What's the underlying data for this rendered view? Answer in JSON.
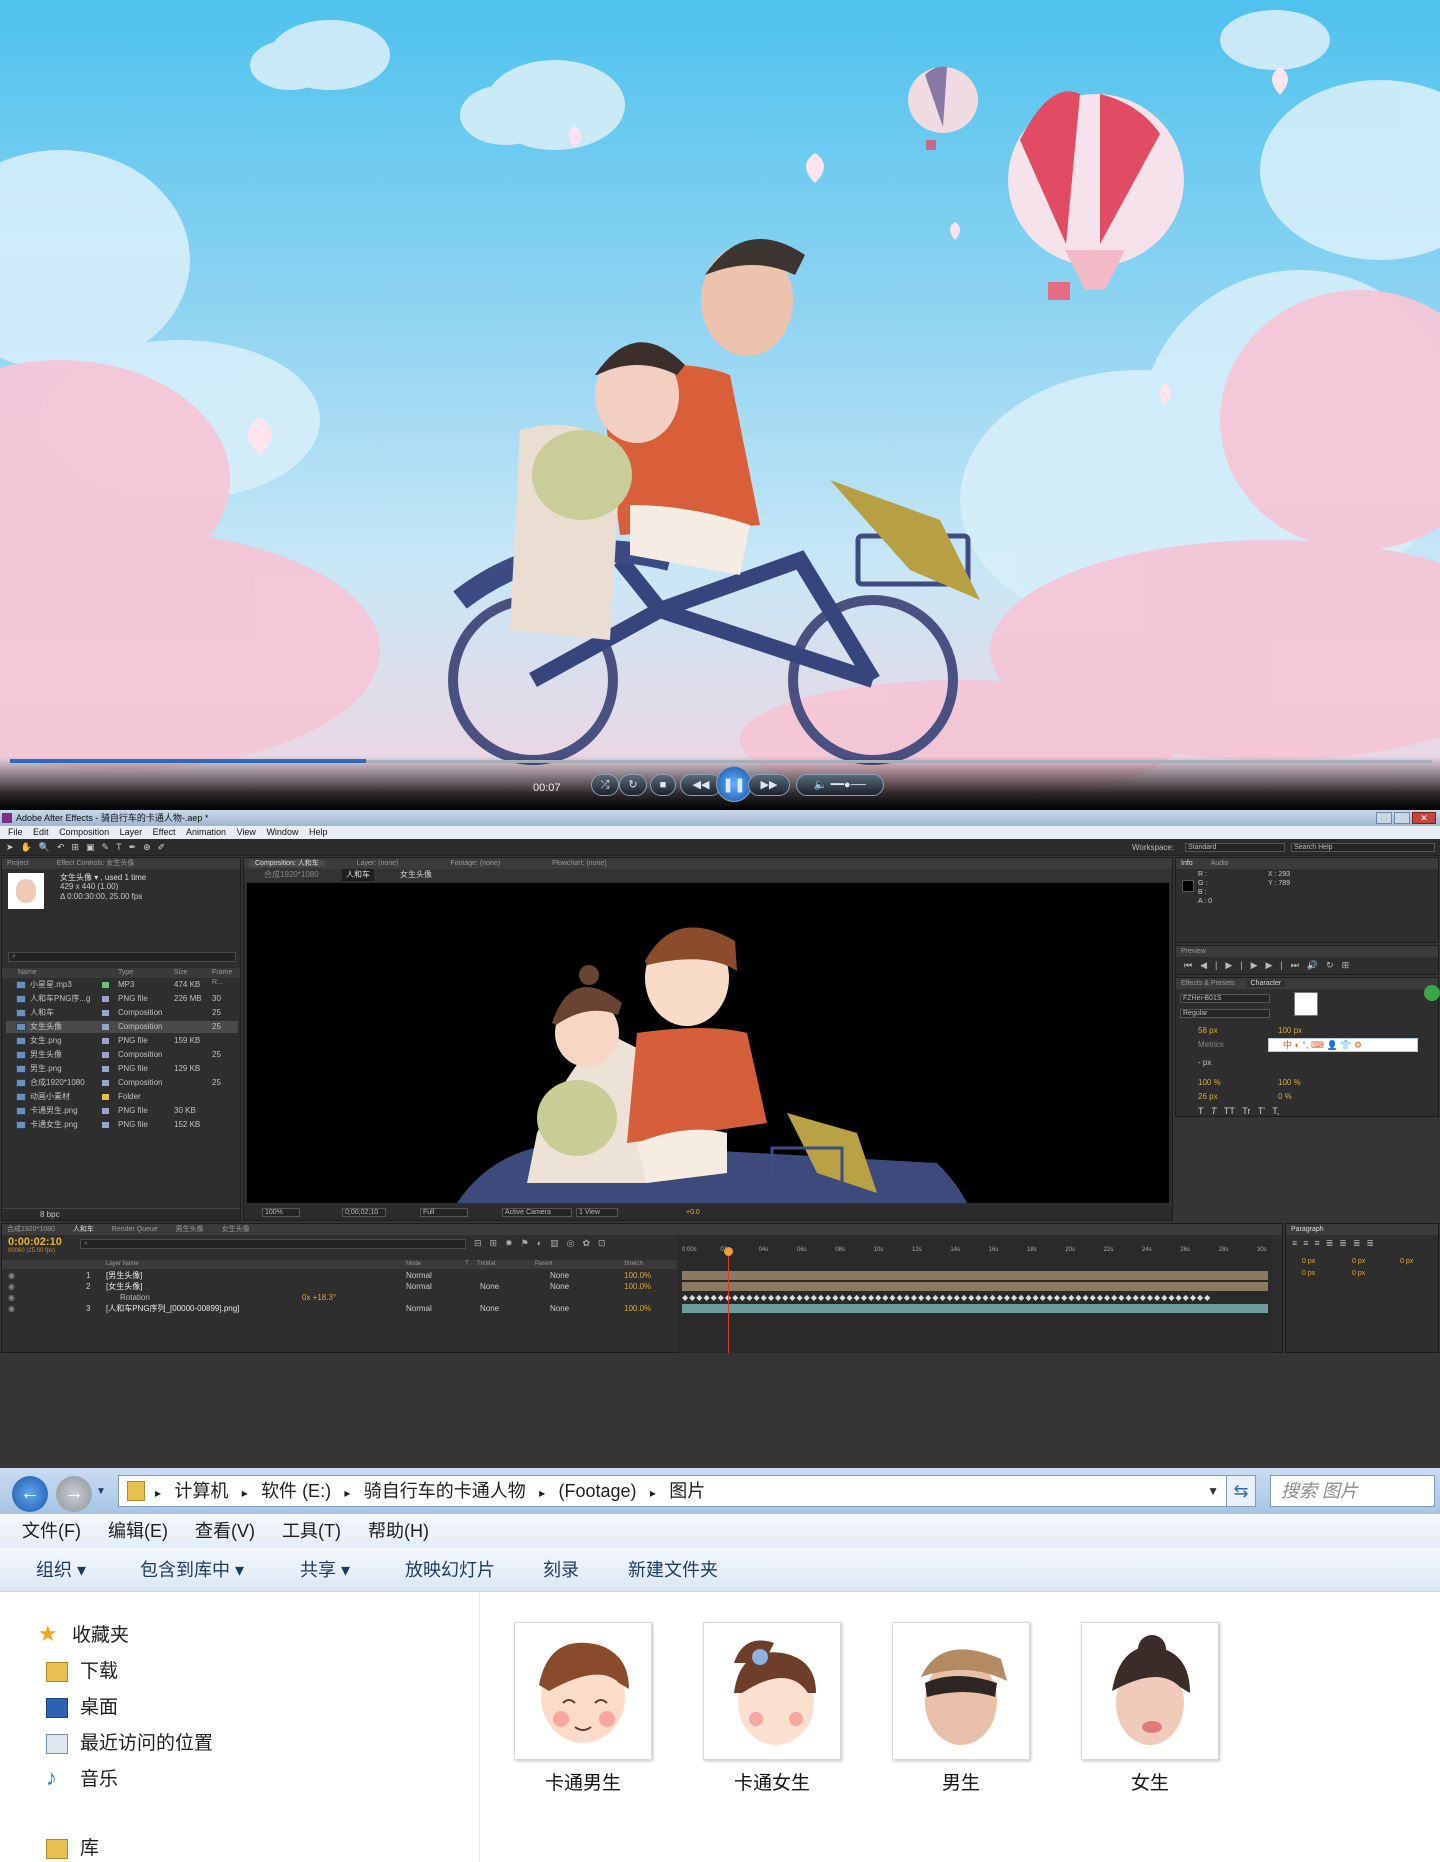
{
  "player": {
    "time": "00:07",
    "progress_fraction": 0.25
  },
  "ae": {
    "title": "Adobe After Effects - 骑自行车的卡通人物-.aep *",
    "menu": [
      "File",
      "Edit",
      "Composition",
      "Layer",
      "Effect",
      "Animation",
      "View",
      "Window",
      "Help"
    ],
    "workspace_label": "Workspace:",
    "workspace_value": "Standard",
    "search_help": "Search Help",
    "project": {
      "tab": "Project",
      "effect_controls_tab": "Effect Controls: 女生头像",
      "selected_name": "女生头像 ▾ , used 1 time",
      "selected_dims": "429 x 440 (1.00)",
      "selected_duration": "Δ 0:00:30:00, 25.00 fps",
      "columns": [
        "Name",
        "Type",
        "Size",
        "Frame R..."
      ],
      "items": [
        {
          "name": "小星星.mp3",
          "type": "MP3",
          "size": "474 KB",
          "fr": "",
          "swatch": "#6dbf7a"
        },
        {
          "name": "人和车PNG序...g",
          "type": "PNG file",
          "size": "226 MB",
          "fr": "30",
          "swatch": "#9aa6c8"
        },
        {
          "name": "人和车",
          "type": "Composition",
          "size": "",
          "fr": "25",
          "swatch": "#9aa6c8"
        },
        {
          "name": "女生头像",
          "type": "Composition",
          "size": "",
          "fr": "25",
          "swatch": "#9aa6c8"
        },
        {
          "name": "女生.png",
          "type": "PNG file",
          "size": "159 KB",
          "fr": "",
          "swatch": "#9aa6c8"
        },
        {
          "name": "男生头像",
          "type": "Composition",
          "size": "",
          "fr": "25",
          "swatch": "#9aa6c8"
        },
        {
          "name": "男生.png",
          "type": "PNG file",
          "size": "129 KB",
          "fr": "",
          "swatch": "#9aa6c8"
        },
        {
          "name": "合成1920*1080",
          "type": "Composition",
          "size": "",
          "fr": "25",
          "swatch": "#9aa6c8"
        },
        {
          "name": "动画小素材",
          "type": "Folder",
          "size": "",
          "fr": "",
          "swatch": "#e0c24a"
        },
        {
          "name": "卡通男生.png",
          "type": "PNG file",
          "size": "30 KB",
          "fr": "",
          "swatch": "#9aa6c8"
        },
        {
          "name": "卡通女生.png",
          "type": "PNG file",
          "size": "152 KB",
          "fr": "",
          "swatch": "#9aa6c8"
        }
      ],
      "bpc": "8 bpc"
    },
    "comp": {
      "tab": "Composition: 人和车",
      "layer_tab": "Layer: (none)",
      "footage_tab": "Footage: (none)",
      "flowchart_tab": "Flowchart: (none)",
      "crumbs": [
        "合成1920*1080",
        "人和车",
        "女生头像"
      ],
      "zoom": "100%",
      "timecode": "0;00;02;10",
      "resolution": "Full",
      "camera": "Active Camera",
      "view": "1 View",
      "exposure": "+0.0"
    },
    "info": {
      "tab": "Info",
      "audio_tab": "Audio",
      "r": "R :",
      "g": "G :",
      "b": "B :",
      "a": "A : 0",
      "x": "X : 293",
      "y": "Y : 789"
    },
    "preview_tab": "Preview",
    "effects_tab": "Effects & Presets",
    "character": {
      "tab": "Character",
      "font": "FZHei-B01S",
      "style": "Regular",
      "size": "58 px",
      "leading": "100 px",
      "tracking": "Metrics",
      "stroke": "- px",
      "vscale": "100 %",
      "hscale": "100 %",
      "baseline": "26 px",
      "tsume": "0 %",
      "styles": [
        "T",
        "T",
        "TT",
        "Tr",
        "T'",
        "T,"
      ],
      "ime": "中"
    },
    "timeline": {
      "tabs": [
        "合成1920*1080",
        "人和车",
        "Render Queue",
        "男生头像",
        "女生头像"
      ],
      "timecode": "0:00:02:10",
      "subframe": "00060 (25.00 fps)",
      "col_layer": "Layer Name",
      "col_mode": "Mode",
      "col_t": "T",
      "col_trkmat": "TrkMat",
      "col_parent": "Parent",
      "col_stretch": "Stretch",
      "ruler": [
        "0:00s",
        "02s",
        "04s",
        "06s",
        "08s",
        "10s",
        "12s",
        "14s",
        "16s",
        "18s",
        "20s",
        "22s",
        "24s",
        "26s",
        "28s",
        "30s"
      ],
      "layers": [
        {
          "num": "1",
          "name": "[男生头像]",
          "mode": "Normal",
          "trk": "",
          "parent": "None",
          "stretch": "100.0%"
        },
        {
          "num": "2",
          "name": "[女生头像]",
          "mode": "Normal",
          "trk": "None",
          "parent": "None",
          "stretch": "100.0%"
        },
        {
          "num": "",
          "name": "Rotation",
          "mode": "0x +18.3°",
          "trk": "",
          "parent": "",
          "stretch": ""
        },
        {
          "num": "3",
          "name": "[人和车PNG序列_[00000-00899].png]",
          "mode": "Normal",
          "trk": "None",
          "parent": "None",
          "stretch": "100.0%"
        }
      ]
    },
    "paragraph": {
      "tab": "Paragraph",
      "values": [
        "0 px",
        "0 px",
        "0 px",
        "0 px",
        "0 px"
      ]
    }
  },
  "explorer": {
    "breadcrumb": [
      "计算机",
      "软件 (E:)",
      "骑自行车的卡通人物",
      "(Footage)",
      "图片"
    ],
    "search_placeholder": "搜索 图片",
    "menu": [
      "文件(F)",
      "编辑(E)",
      "查看(V)",
      "工具(T)",
      "帮助(H)"
    ],
    "commands": [
      "组织 ▾",
      "包含到库中 ▾",
      "共享 ▾",
      "放映幻灯片",
      "刻录",
      "新建文件夹"
    ],
    "nav": [
      {
        "label": "收藏夹",
        "icon": "star-icon"
      },
      {
        "label": "下载",
        "icon": "download-folder-icon"
      },
      {
        "label": "桌面",
        "icon": "desktop-icon"
      },
      {
        "label": "最近访问的位置",
        "icon": "recent-places-icon"
      },
      {
        "label": "音乐",
        "icon": "music-icon"
      },
      {
        "label": "库",
        "icon": "library-icon"
      }
    ],
    "files": [
      {
        "label": "卡通男生",
        "icon": "cartoon-boy-face-icon"
      },
      {
        "label": "卡通女生",
        "icon": "cartoon-girl-face-icon"
      },
      {
        "label": "男生",
        "icon": "boy-photo-icon"
      },
      {
        "label": "女生",
        "icon": "girl-photo-icon"
      }
    ]
  }
}
